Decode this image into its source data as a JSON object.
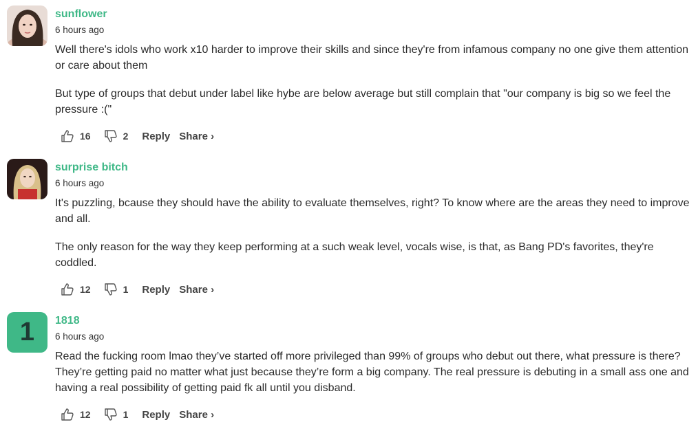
{
  "comments": [
    {
      "author": "sunflower",
      "time": "6 hours ago",
      "avatar": "photo",
      "paragraphs": [
        "Well there's idols who work x10 harder to improve their skills and since they're from infamous company no one give them attention or care about them",
        "But type of groups that debut under label like hybe are below average but still complain that \"our company is big so we feel the pressure :(\""
      ],
      "upvotes": "16",
      "downvotes": "2"
    },
    {
      "author": "surprise bitch",
      "time": "6 hours ago",
      "avatar": "photo",
      "paragraphs": [
        "It's puzzling, bcause they should have the ability to evaluate themselves, right? To know where are the areas they need to improve and all.",
        "The only reason for the way they keep performing at a such weak level, vocals wise, is that, as Bang PD's favorites, they're coddled."
      ],
      "upvotes": "12",
      "downvotes": "1"
    },
    {
      "author": "1818",
      "time": "6 hours ago",
      "avatar_letter": "1",
      "avatar_color": "#3fb887",
      "paragraphs": [
        "Read the fucking room lmao they’ve started off more privileged than 99% of groups who debut out there, what pressure is there? They’re getting paid no matter what just because they’re form a big company. The real pressure is debuting in a small ass one and having a real possibility of getting paid fk all until you disband."
      ],
      "upvotes": "12",
      "downvotes": "1"
    }
  ],
  "labels": {
    "reply": "Reply",
    "share": "Share ›"
  },
  "icons": {
    "upvote": "thumbs-up-icon",
    "downvote": "thumbs-down-icon",
    "minimize": "minimize-icon",
    "flag": "flag-icon"
  },
  "colors": {
    "author": "#3fb887",
    "text": "#2a2a2a"
  }
}
